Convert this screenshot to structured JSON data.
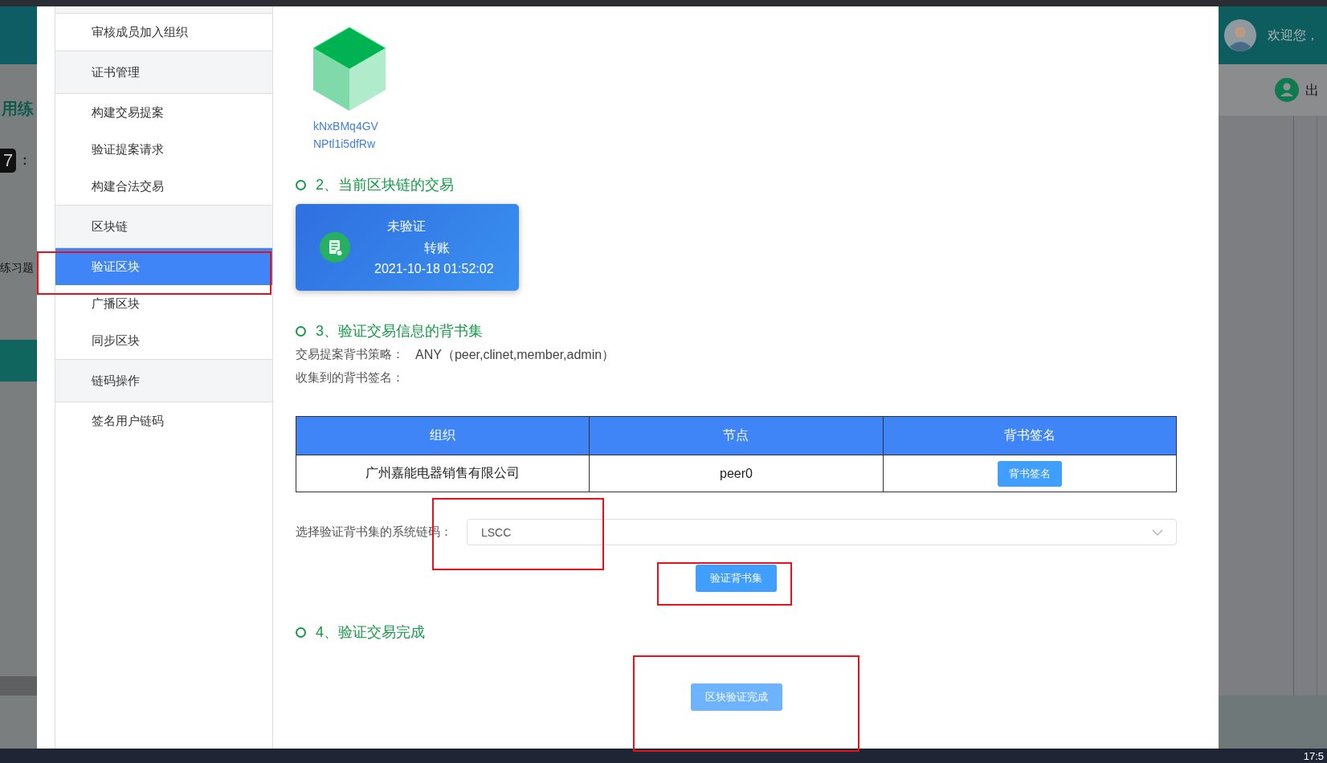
{
  "background_left": {
    "heading": "用练",
    "badge": "7",
    "colon": ":",
    "link": "练习题"
  },
  "background_right": {
    "greeting": "欢迎您，",
    "user_button": "出"
  },
  "sidebar": {
    "items": [
      {
        "label": "审核成员加入组织",
        "kind": "item",
        "selected": false
      },
      {
        "label": "证书管理",
        "kind": "group",
        "selected": false
      },
      {
        "label": "构建交易提案",
        "kind": "item",
        "selected": false
      },
      {
        "label": "验证提案请求",
        "kind": "item",
        "selected": false
      },
      {
        "label": "构建合法交易",
        "kind": "item",
        "selected": false
      },
      {
        "label": "区块链",
        "kind": "group",
        "selected": false
      },
      {
        "label": "验证区块",
        "kind": "item",
        "selected": true
      },
      {
        "label": "广播区块",
        "kind": "item",
        "selected": false
      },
      {
        "label": "同步区块",
        "kind": "item",
        "selected": false
      },
      {
        "label": "链码操作",
        "kind": "group",
        "selected": false
      },
      {
        "label": "签名用户链码",
        "kind": "item",
        "selected": false
      }
    ]
  },
  "block": {
    "hash_lines": [
      "kNxBMq4GV",
      "NPtl1i5dfRw"
    ]
  },
  "transaction_section": {
    "heading": "2、当前区块链的交易",
    "card": {
      "status": "未验证",
      "type": "转账",
      "time": "2021-10-18 01:52:02"
    }
  },
  "endorsement_section": {
    "heading": "3、验证交易信息的背书集",
    "policy_label": "交易提案背书策略：",
    "policy_value": "ANY（peer,clinet,member,admin）",
    "collected_label": "收集到的背书签名：",
    "table": {
      "columns": [
        "组织",
        "节点",
        "背书签名"
      ],
      "rows": [
        {
          "org": "广州嘉能电器销售有限公司",
          "peer": "peer0",
          "action": "背书签名"
        }
      ]
    },
    "chaincode_label": "选择验证背书集的系统链码：",
    "chaincode_value": "LSCC",
    "verify_button": {
      "label": "验证背书集",
      "disabled": false
    }
  },
  "complete_section": {
    "heading": "4、验证交易完成",
    "button": {
      "label": "区块验证完成",
      "disabled": true
    }
  },
  "taskbar": {
    "time": "17:5"
  }
}
